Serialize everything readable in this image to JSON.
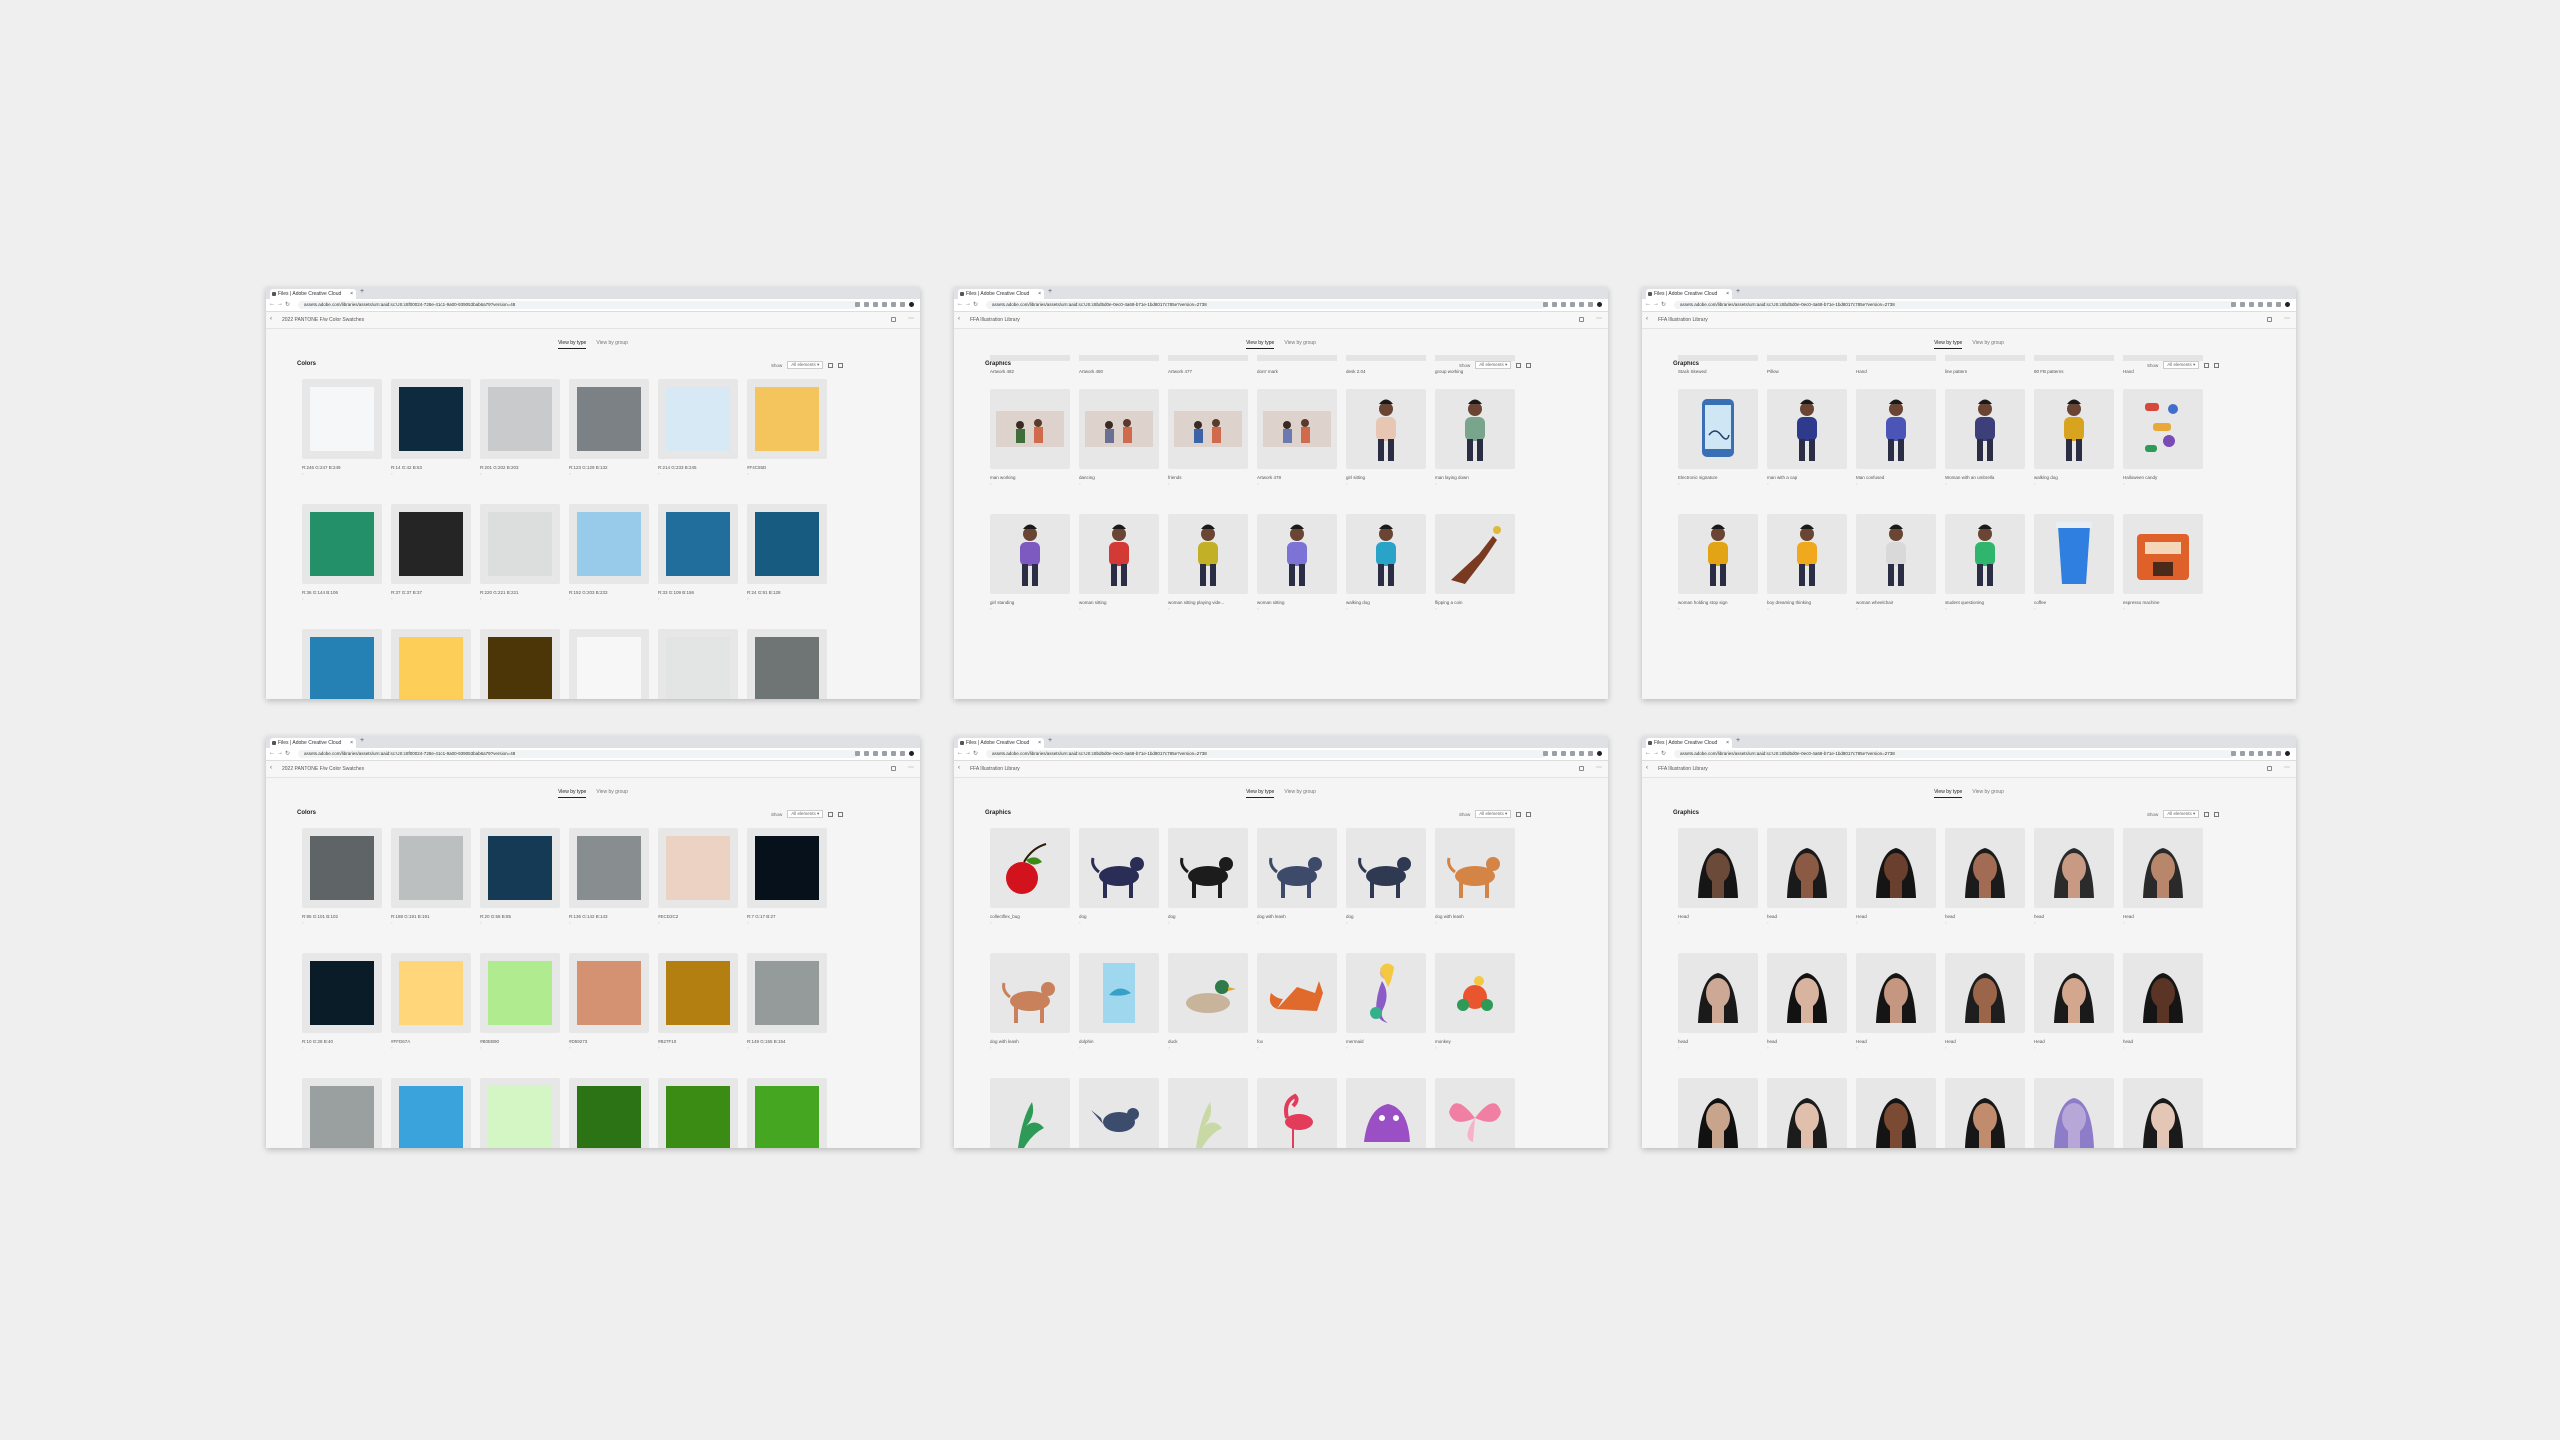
{
  "windows": [
    {
      "id": "w1",
      "tab": "Files | Adobe Creative Cloud",
      "url": "assets.adobe.com/libraries/assets/urn:aaid:sc:US:c8f00024-728e-41c1-9a00-939053bab6a79?version=48",
      "lib": "2022 PANTONE F/w Color Swatches",
      "tabs": [
        "View by type",
        "View by group"
      ],
      "section": "Colors",
      "show": "Show",
      "filter": "All elements",
      "items": [
        {
          "kind": "swatch",
          "color": "#f6f7f9",
          "label": "R:246 G:247 B:249"
        },
        {
          "kind": "swatch",
          "color": "#0e2a3f",
          "label": "R:14 G:42 B:63"
        },
        {
          "kind": "swatch",
          "color": "#c9cacb",
          "label": "R:201 G:202 B:203"
        },
        {
          "kind": "swatch",
          "color": "#7b8184",
          "label": "R:123 G:129 B:132"
        },
        {
          "kind": "swatch",
          "color": "#d6e9f5",
          "label": "R:214 G:233 B:245"
        },
        {
          "kind": "swatch",
          "color": "#f4c55d",
          "label": "#F4C55D"
        },
        {
          "kind": "swatch",
          "color": "#24906a",
          "label": "R:36 G:144 B:106"
        },
        {
          "kind": "swatch",
          "color": "#252525",
          "label": "R:37 G:37 B:37"
        },
        {
          "kind": "swatch",
          "color": "#dcdddd",
          "label": "R:220 G:221 B:221"
        },
        {
          "kind": "swatch",
          "color": "#98cbe9",
          "label": "R:152 G:203 B:233"
        },
        {
          "kind": "swatch",
          "color": "#216d9c",
          "label": "R:33 G:109 B:156"
        },
        {
          "kind": "swatch",
          "color": "#185b80",
          "label": "R:24 G:91 B:128"
        },
        {
          "kind": "swatch",
          "color": "#2580b3",
          "label": ""
        },
        {
          "kind": "swatch",
          "color": "#fdcf58",
          "label": ""
        },
        {
          "kind": "swatch",
          "color": "#4c3507",
          "label": ""
        },
        {
          "kind": "swatch",
          "color": "#f7f7f7",
          "label": ""
        },
        {
          "kind": "swatch",
          "color": "#e3e4e4",
          "label": ""
        },
        {
          "kind": "swatch",
          "color": "#6f7475",
          "label": ""
        }
      ]
    },
    {
      "id": "w2",
      "tab": "Files | Adobe Creative Cloud",
      "url": "assets.adobe.com/libraries/assets/urn:aaid:sc:US:c8bd5d0e-0ec0-4a68-b71e-1bd8017c785e?version=2738",
      "lib": "FFA Illustration Library",
      "tabs": [
        "View by type",
        "View by group"
      ],
      "section": "Graphics",
      "show": "Show",
      "filter": "All elements",
      "toprow": [
        "Artwork 482",
        "Artwork 480",
        "Artwork 477",
        "dont' mark",
        "desk 2.04",
        "group working"
      ],
      "items": [
        {
          "kind": "art",
          "scene": "scene",
          "fig": "#3f6e3a",
          "label": "man working"
        },
        {
          "kind": "art",
          "scene": "scene",
          "fig": "#6a6f94",
          "label": "dancing"
        },
        {
          "kind": "art",
          "scene": "scene",
          "fig": "#3b63a8",
          "label": "friends"
        },
        {
          "kind": "art",
          "scene": "scene",
          "fig": "#6b79b2",
          "label": "Artwork 478"
        },
        {
          "kind": "art",
          "scene": "person",
          "fig": "#e7c7b4",
          "label": "girl sitting"
        },
        {
          "kind": "art",
          "scene": "person",
          "fig": "#7aa58d",
          "label": "man laying down"
        },
        {
          "kind": "art",
          "scene": "person",
          "fig": "#7c5ac0",
          "label": "girl standing"
        },
        {
          "kind": "art",
          "scene": "person",
          "fig": "#d33a35",
          "label": "woman sitting"
        },
        {
          "kind": "art",
          "scene": "person",
          "fig": "#c2b026",
          "label": "woman sitting playing vide..."
        },
        {
          "kind": "art",
          "scene": "person",
          "fig": "#7d72d6",
          "label": "woman sitting"
        },
        {
          "kind": "art",
          "scene": "person",
          "fig": "#2aa3c9",
          "label": "walking dog"
        },
        {
          "kind": "art",
          "scene": "hand",
          "fig": "#7a3a22",
          "label": "flipping a coin"
        }
      ]
    },
    {
      "id": "w3",
      "tab": "Files | Adobe Creative Cloud",
      "url": "assets.adobe.com/libraries/assets/urn:aaid:sc:US:c8bd5d0e-0ec0-4a68-b71e-1bd8017c785e?version=2738",
      "lib": "FFA Illustration Library",
      "tabs": [
        "View by type",
        "View by group"
      ],
      "section": "Graphics",
      "show": "Show",
      "filter": "All elements",
      "toprow": [
        "Stack Skewed",
        "Pillow",
        "Hand",
        "line pattern",
        "80 FB patterns",
        "Hand"
      ],
      "items": [
        {
          "kind": "art",
          "scene": "phone",
          "fig": "#3b6fb5",
          "label": "Electronic signature"
        },
        {
          "kind": "art",
          "scene": "person",
          "fig": "#2e3a8c",
          "label": "man with a cap"
        },
        {
          "kind": "art",
          "scene": "person",
          "fig": "#4b55b8",
          "label": "Man confused"
        },
        {
          "kind": "art",
          "scene": "person",
          "fig": "#3c3f7a",
          "label": "Woman with an umbrella"
        },
        {
          "kind": "art",
          "scene": "person",
          "fig": "#d8a31e",
          "label": "walking dog"
        },
        {
          "kind": "art",
          "scene": "objects",
          "fig": "#d8473c",
          "label": "Halloween candy"
        },
        {
          "kind": "art",
          "scene": "person",
          "fig": "#e2a414",
          "label": "woman holding stop sign"
        },
        {
          "kind": "art",
          "scene": "person",
          "fig": "#f0a91c",
          "label": "boy dreaming thinking"
        },
        {
          "kind": "art",
          "scene": "person",
          "fig": "#d9d9d9",
          "label": "woman wheelchair"
        },
        {
          "kind": "art",
          "scene": "person",
          "fig": "#2fb56e",
          "label": "student questioning"
        },
        {
          "kind": "art",
          "scene": "cup",
          "fig": "#2e7fe0",
          "label": "coffee"
        },
        {
          "kind": "art",
          "scene": "machine",
          "fig": "#e0602a",
          "label": "espresso machine"
        }
      ]
    },
    {
      "id": "w4",
      "tab": "Files | Adobe Creative Cloud",
      "url": "assets.adobe.com/libraries/assets/urn:aaid:sc:US:c8f00024-728e-41c1-9a00-939053bab6a79?version=48",
      "lib": "2022 PANTONE F/w Color Swatches",
      "tabs": [
        "View by type",
        "View by group"
      ],
      "section": "Colors",
      "show": "Show",
      "filter": "All elements",
      "items": [
        {
          "kind": "swatch",
          "color": "#5f6566",
          "label": "R:95 G:101 B:102"
        },
        {
          "kind": "swatch",
          "color": "#bcbfbf",
          "label": "R:188 G:191 B:191"
        },
        {
          "kind": "swatch",
          "color": "#143a55",
          "label": "R:20 G:58 B:85"
        },
        {
          "kind": "swatch",
          "color": "#888e8f",
          "label": "R:136 G:142 B:143"
        },
        {
          "kind": "swatch",
          "color": "#ecd2c2",
          "label": "#ECD2C2"
        },
        {
          "kind": "swatch",
          "color": "#07111b",
          "label": "R:7 G:17 B:27"
        },
        {
          "kind": "swatch",
          "color": "#0a1c28",
          "label": "R:10 G:28 B:40"
        },
        {
          "kind": "swatch",
          "color": "#ffd67a",
          "label": "#FFD67A"
        },
        {
          "kind": "swatch",
          "color": "#b0eb90",
          "label": "#B0EB90"
        },
        {
          "kind": "swatch",
          "color": "#d59273",
          "label": "#D59273"
        },
        {
          "kind": "swatch",
          "color": "#b27f10",
          "label": "#B27F10"
        },
        {
          "kind": "swatch",
          "color": "#959b9a",
          "label": "R:149 G:155 B:154"
        },
        {
          "kind": "swatch",
          "color": "#9a9fa0",
          "label": ""
        },
        {
          "kind": "swatch",
          "color": "#3aa3dc",
          "label": ""
        },
        {
          "kind": "swatch",
          "color": "#d4f5c4",
          "label": ""
        },
        {
          "kind": "swatch",
          "color": "#2c7315",
          "label": ""
        },
        {
          "kind": "swatch",
          "color": "#3b8c14",
          "label": ""
        },
        {
          "kind": "swatch",
          "color": "#45a622",
          "label": ""
        }
      ]
    },
    {
      "id": "w5",
      "tab": "Files | Adobe Creative Cloud",
      "url": "assets.adobe.com/libraries/assets/urn:aaid:sc:US:c8bd5d0e-0ec0-4a68-b71e-1bd8017c785e?version=2738",
      "lib": "FFA Illustration Library",
      "tabs": [
        "View by type",
        "View by group"
      ],
      "section": "Graphics",
      "show": "Show",
      "filter": "All elements",
      "items": [
        {
          "kind": "art",
          "scene": "apple",
          "fig": "#d2121c",
          "label": "collectflex_bug"
        },
        {
          "kind": "art",
          "scene": "dog",
          "fig": "#2a2d55",
          "label": "dog"
        },
        {
          "kind": "art",
          "scene": "dog",
          "fig": "#1c1c1c",
          "label": "dog"
        },
        {
          "kind": "art",
          "scene": "dog",
          "fig": "#3e4a6a",
          "label": "dog with leash"
        },
        {
          "kind": "art",
          "scene": "dog",
          "fig": "#2f3a52",
          "label": "dog"
        },
        {
          "kind": "art",
          "scene": "dog",
          "fig": "#d48444",
          "label": "dog with leash"
        },
        {
          "kind": "art",
          "scene": "dog",
          "fig": "#c8815a",
          "label": "dog with leash"
        },
        {
          "kind": "art",
          "scene": "sea",
          "fig": "#37a0c8",
          "label": "dolphin"
        },
        {
          "kind": "art",
          "scene": "duck",
          "fig": "#2f7a4a",
          "label": "duck"
        },
        {
          "kind": "art",
          "scene": "fox",
          "fig": "#e06a2b",
          "label": "fox"
        },
        {
          "kind": "art",
          "scene": "mermaid",
          "fig": "#8b5bc6",
          "label": "mermaid"
        },
        {
          "kind": "art",
          "scene": "flower",
          "fig": "#e9552f",
          "label": "monkey"
        },
        {
          "kind": "art",
          "scene": "plant",
          "fig": "#2e9a57",
          "label": ""
        },
        {
          "kind": "art",
          "scene": "bird",
          "fig": "#3c4c6c",
          "label": ""
        },
        {
          "kind": "art",
          "scene": "plant",
          "fig": "#c8d9a6",
          "label": ""
        },
        {
          "kind": "art",
          "scene": "flamingo",
          "fig": "#e33c5a",
          "label": ""
        },
        {
          "kind": "art",
          "scene": "creature",
          "fig": "#9a4fc4",
          "label": ""
        },
        {
          "kind": "art",
          "scene": "butterfly",
          "fig": "#f07fa3",
          "label": ""
        }
      ]
    },
    {
      "id": "w6",
      "tab": "Files | Adobe Creative Cloud",
      "url": "assets.adobe.com/libraries/assets/urn:aaid:sc:US:c8bd5d0e-0ec0-4a68-b71e-1bd8017c785e?version=2738",
      "lib": "FFA Illustration Library",
      "tabs": [
        "View by type",
        "View by group"
      ],
      "section": "Graphics",
      "show": "Show",
      "filter": "All elements",
      "items": [
        {
          "kind": "head",
          "skin": "#6b4a3a",
          "hair": "#161616",
          "label": "Head"
        },
        {
          "kind": "head",
          "skin": "#8a5a44",
          "hair": "#1a1a1a",
          "label": "head"
        },
        {
          "kind": "head",
          "skin": "#6a3f2e",
          "hair": "#151515",
          "label": "Head"
        },
        {
          "kind": "head",
          "skin": "#a26c54",
          "hair": "#1b1b1b",
          "label": "head"
        },
        {
          "kind": "head",
          "skin": "#c99a83",
          "hair": "#2b2b2b",
          "label": "head"
        },
        {
          "kind": "head",
          "skin": "#b8866b",
          "hair": "#2a2a2a",
          "label": "Head"
        },
        {
          "kind": "head",
          "skin": "#cda894",
          "hair": "#1a1a1a",
          "label": "head"
        },
        {
          "kind": "head",
          "skin": "#d7b3a0",
          "hair": "#121212",
          "label": "head"
        },
        {
          "kind": "head",
          "skin": "#c59680",
          "hair": "#151515",
          "label": "Head"
        },
        {
          "kind": "head",
          "skin": "#9a6548",
          "hair": "#1e1e1e",
          "label": "Head"
        },
        {
          "kind": "head",
          "skin": "#d3a68e",
          "hair": "#1a1a1a",
          "label": "Head"
        },
        {
          "kind": "head",
          "skin": "#5a3525",
          "hair": "#151515",
          "label": "head"
        },
        {
          "kind": "head",
          "skin": "#c9a48c",
          "hair": "#111111",
          "label": ""
        },
        {
          "kind": "head",
          "skin": "#e0c0ac",
          "hair": "#1c1c1c",
          "label": ""
        },
        {
          "kind": "head",
          "skin": "#7a4a33",
          "hair": "#141414",
          "label": ""
        },
        {
          "kind": "head",
          "skin": "#c18c6e",
          "hair": "#171717",
          "label": ""
        },
        {
          "kind": "head",
          "skin": "#b7a7d8",
          "hair": "#8d7cc7",
          "label": ""
        },
        {
          "kind": "head",
          "skin": "#e4c6b6",
          "hair": "#1a1a1a",
          "label": ""
        }
      ]
    }
  ]
}
